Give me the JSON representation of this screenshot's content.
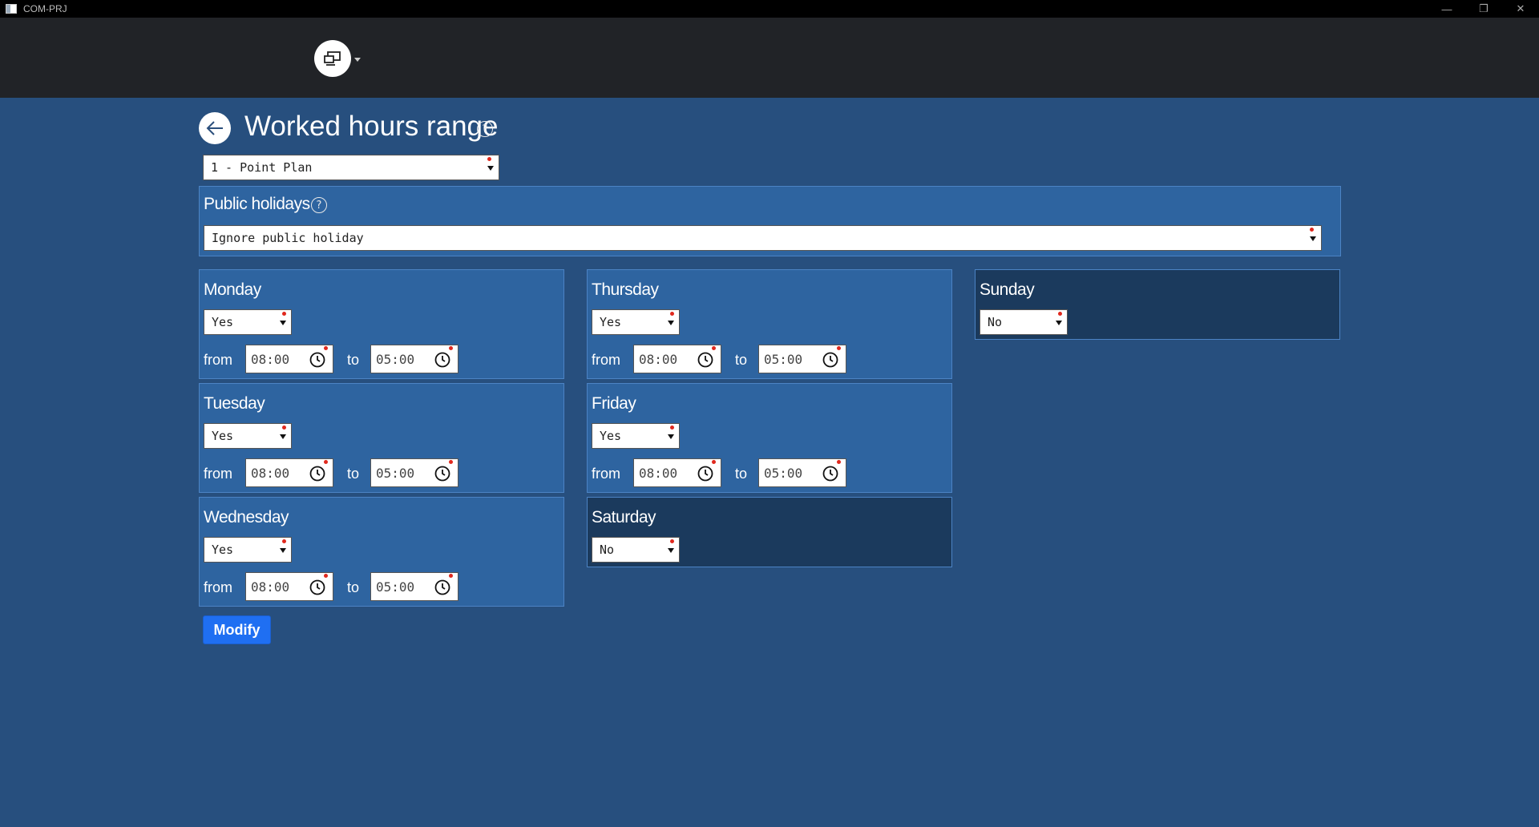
{
  "window": {
    "title": "COM-PRJ",
    "buttons": {
      "minimize": "—",
      "restore": "❐",
      "close": "✕"
    }
  },
  "page": {
    "title": "Worked hours range",
    "help": "?"
  },
  "plan_select": {
    "value": "1 - Point Plan"
  },
  "public_holidays": {
    "label": "Public holidays",
    "help": "?",
    "value": "Ignore public holiday"
  },
  "labels": {
    "from": "from",
    "to": "to"
  },
  "days": [
    {
      "name": "Monday",
      "active": "Yes",
      "from": "08:00",
      "to": "05:00"
    },
    {
      "name": "Tuesday",
      "active": "Yes",
      "from": "08:00",
      "to": "05:00"
    },
    {
      "name": "Wednesday",
      "active": "Yes",
      "from": "08:00",
      "to": "05:00"
    },
    {
      "name": "Thursday",
      "active": "Yes",
      "from": "08:00",
      "to": "05:00"
    },
    {
      "name": "Friday",
      "active": "Yes",
      "from": "08:00",
      "to": "05:00"
    },
    {
      "name": "Saturday",
      "active": "No"
    },
    {
      "name": "Sunday",
      "active": "No"
    }
  ],
  "actions": {
    "modify_label": "Modify"
  },
  "colors": {
    "page_bg": "#274f7e",
    "panel_bg": "#2e64a0",
    "panel_off_bg": "#1b3a5d",
    "header_bg": "#212327",
    "primary_button": "#1f6ff2",
    "required_marker": "#e0281d"
  },
  "icons": [
    "app-window-icon",
    "device-switch-icon",
    "back-arrow-icon",
    "help-icon",
    "clock-icon",
    "dropdown-caret-icon"
  ]
}
